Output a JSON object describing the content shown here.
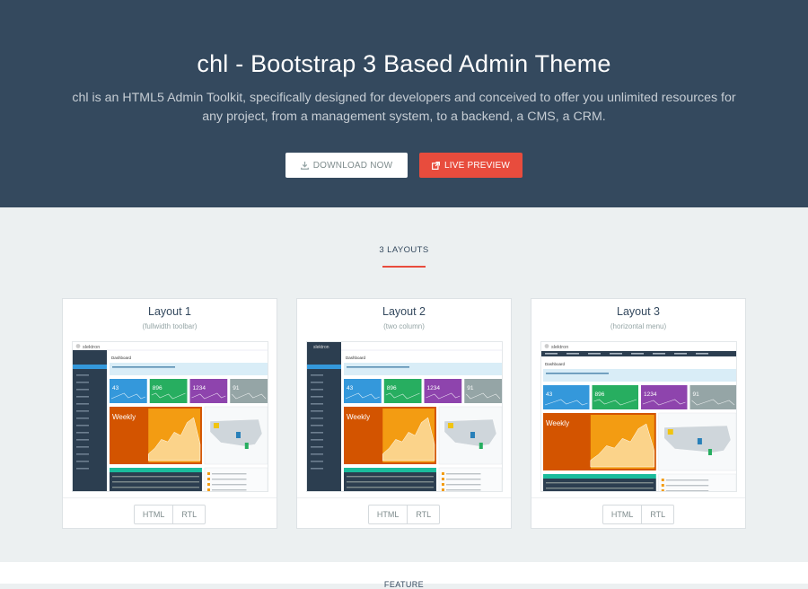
{
  "hero": {
    "title": "chl - Bootstrap 3 Based Admin Theme",
    "description": "chl is an HTML5 Admin Toolkit, specifically designed for developers and conceived to offer you unlimited resources for any project, from a management system, to a backend, a CMS, a CRM.",
    "download_label": "DOWNLOAD NOW",
    "preview_label": "LIVE PREVIEW",
    "download_icon": "download-icon",
    "preview_icon": "external-link-icon"
  },
  "layouts_section": {
    "title": "3 LAYOUTS",
    "cards": [
      {
        "title": "Layout 1",
        "subtitle": "(fullwidth toolbar)",
        "html_label": "HTML",
        "rtl_label": "RTL"
      },
      {
        "title": "Layout 2",
        "subtitle": "(two column)",
        "html_label": "HTML",
        "rtl_label": "RTL"
      },
      {
        "title": "Layout 3",
        "subtitle": "(horizontal menu)",
        "html_label": "HTML",
        "rtl_label": "RTL"
      }
    ]
  },
  "preview": {
    "brand": "slektron",
    "page": "Dashboard",
    "welcome": "Welcome to Slektron Bootstrap 3 Based Admin Toolkit",
    "stats": [
      "43",
      "896",
      "1234",
      "91"
    ],
    "weekly": "Weekly",
    "stat_colors": [
      "#3498db",
      "#27ae60",
      "#8e44ad",
      "#95a5a6"
    ]
  },
  "feature": {
    "title": "FEATURE"
  },
  "colors": {
    "hero_bg": "#34495e",
    "accent": "#e84c3d",
    "page_bg": "#ecf0f1"
  }
}
